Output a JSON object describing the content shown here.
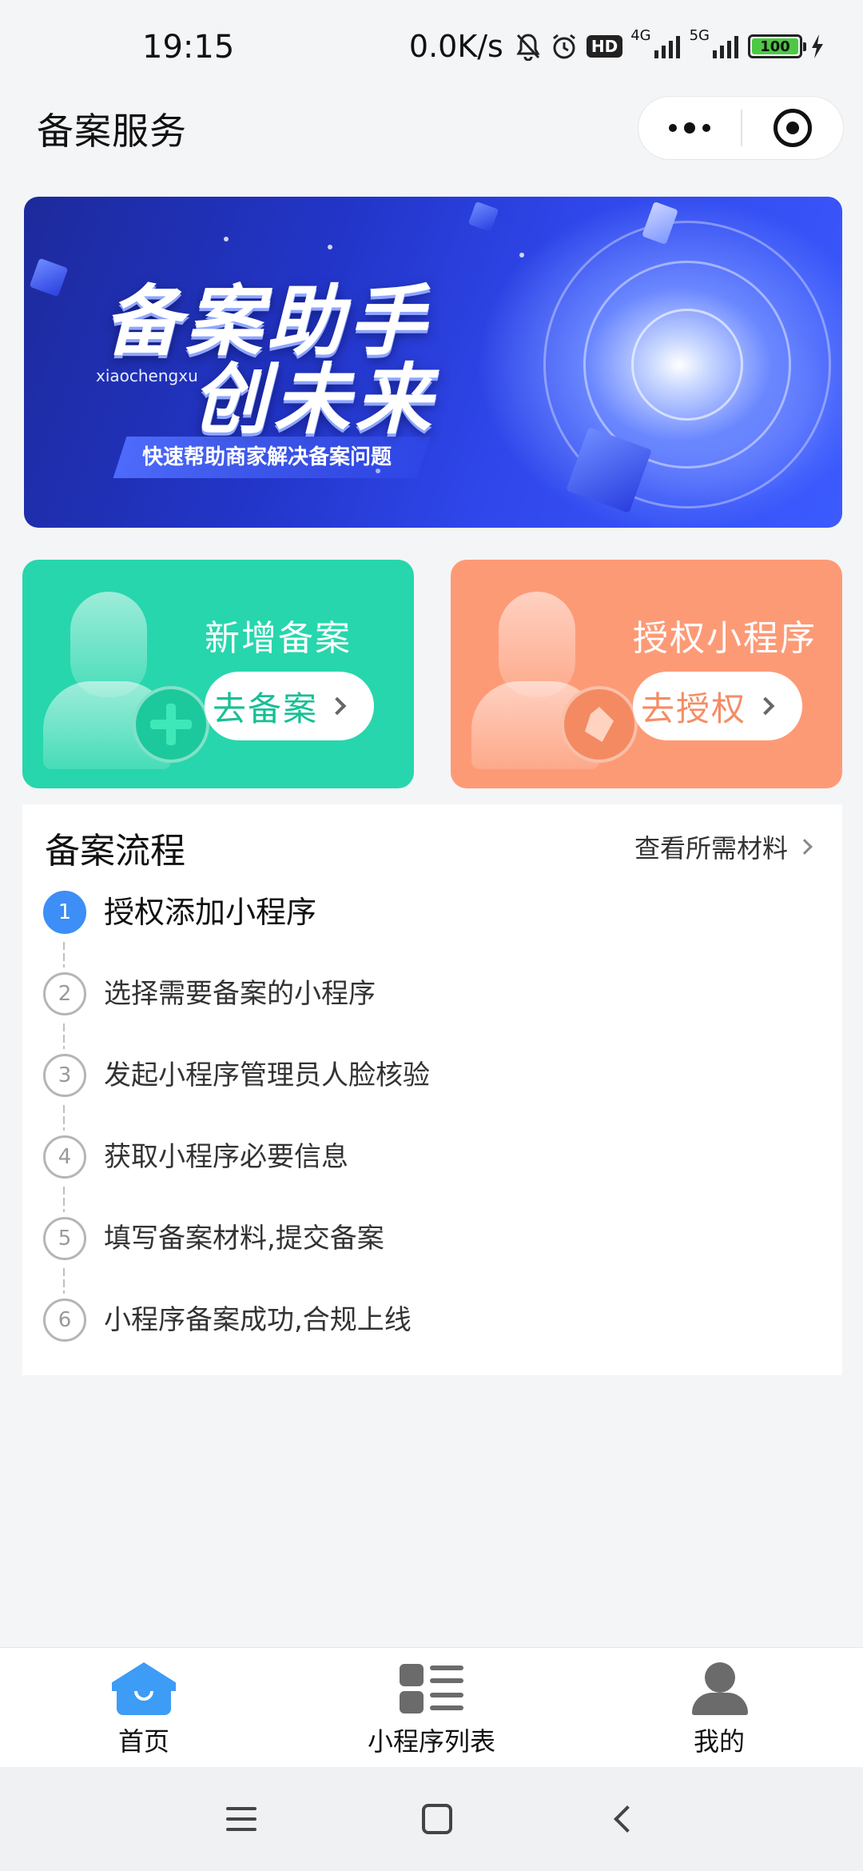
{
  "status_bar": {
    "time": "19:15",
    "net_speed": "0.0K/s",
    "hd_label": "HD",
    "net_4g": "4G",
    "net_5g": "5G",
    "battery_level": "100"
  },
  "header": {
    "title": "备案服务"
  },
  "banner": {
    "title_line1": "备案助手",
    "title_line2": "创未来",
    "subtitle_en": "xiaochengxu",
    "slogan": "快速帮助商家解决备案问题"
  },
  "actions": {
    "add": {
      "title": "新增备案",
      "button": "去备案",
      "color": "#27d6ac"
    },
    "auth": {
      "title": "授权小程序",
      "button": "去授权",
      "color": "#fd9a76"
    }
  },
  "process": {
    "title": "备案流程",
    "materials_link": "查看所需材料",
    "steps": [
      {
        "num": "1",
        "label": "授权添加小程序"
      },
      {
        "num": "2",
        "label": "选择需要备案的小程序"
      },
      {
        "num": "3",
        "label": "发起小程序管理员人脸核验"
      },
      {
        "num": "4",
        "label": "获取小程序必要信息"
      },
      {
        "num": "5",
        "label": "填写备案材料,提交备案"
      },
      {
        "num": "6",
        "label": "小程序备案成功,合规上线"
      }
    ]
  },
  "tabs": [
    {
      "label": "首页",
      "icon": "home-icon",
      "active": true
    },
    {
      "label": "小程序列表",
      "icon": "list-icon",
      "active": false
    },
    {
      "label": "我的",
      "icon": "user-icon",
      "active": false
    }
  ],
  "colors": {
    "accent_blue": "#3d8ef7",
    "home_tab_blue": "#3d9cf5"
  }
}
